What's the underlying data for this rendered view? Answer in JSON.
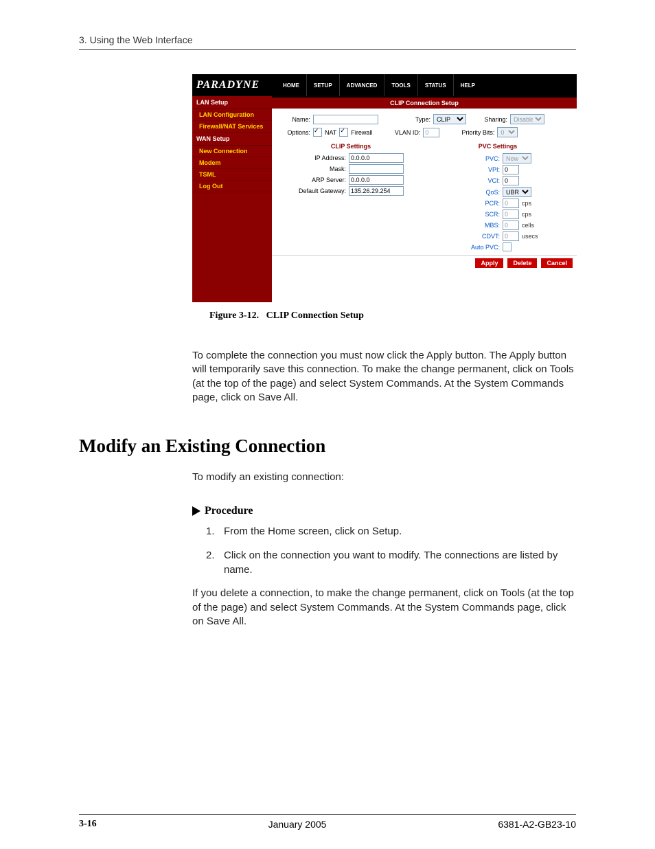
{
  "header": "3. Using the Web Interface",
  "brand": "PARADYNE",
  "nav": [
    "HOME",
    "SETUP",
    "ADVANCED",
    "TOOLS",
    "STATUS",
    "HELP"
  ],
  "sidebar": {
    "lan_setup": "LAN Setup",
    "lan_config": "LAN Configuration",
    "firewall": "Firewall/NAT Services",
    "wan_setup": "WAN Setup",
    "new_conn": "New Connection",
    "modem": "Modem",
    "tsml": "TSML",
    "logout": "Log Out"
  },
  "panel_title": "CLIP Connection Setup",
  "form": {
    "name_label": "Name:",
    "name_value": "",
    "type_label": "Type:",
    "type_value": "CLIP",
    "sharing_label": "Sharing:",
    "sharing_value": "Disable",
    "options_label": "Options:",
    "nat_label": "NAT",
    "firewall_label": "Firewall",
    "vlan_id_label": "VLAN ID:",
    "vlan_id_value": "0",
    "priority_label": "Priority Bits:",
    "priority_value": "0"
  },
  "clip_settings": {
    "title": "CLIP Settings",
    "ip_label": "IP Address:",
    "ip_value": "0.0.0.0",
    "mask_label": "Mask:",
    "mask_value": "",
    "arp_label": "ARP Server:",
    "arp_value": "0.0.0.0",
    "gw_label": "Default Gateway:",
    "gw_value": "135.26.29.254"
  },
  "pvc_settings": {
    "title": "PVC Settings",
    "pvc_label": "PVC:",
    "pvc_value": "New",
    "vpi_label": "VPI:",
    "vpi_value": "0",
    "vci_label": "VCI:",
    "vci_value": "0",
    "qos_label": "QoS:",
    "qos_value": "UBR",
    "pcr_label": "PCR:",
    "pcr_value": "0",
    "pcr_unit": "cps",
    "scr_label": "SCR:",
    "scr_value": "0",
    "scr_unit": "cps",
    "mbs_label": "MBS:",
    "mbs_value": "0",
    "mbs_unit": "cells",
    "cdvt_label": "CDVT:",
    "cdvt_value": "0",
    "cdvt_unit": "usecs",
    "autopvc_label": "Auto PVC:"
  },
  "buttons": {
    "apply": "Apply",
    "delete": "Delete",
    "cancel": "Cancel"
  },
  "figure_caption_num": "Figure 3-12.",
  "figure_caption_text": "CLIP Connection Setup",
  "para1": "To complete the connection you must now click the Apply button. The Apply button will temporarily save this connection. To make the change permanent, click on Tools (at the top of the page) and select System Commands. At the System Commands page, click on Save All.",
  "section_title": "Modify an Existing Connection",
  "para2": "To modify an existing connection:",
  "procedure_label": "Procedure",
  "steps": [
    "From the Home screen, click on Setup.",
    "Click on the connection you want to modify. The connections are listed by name."
  ],
  "para3": "If you delete a connection, to make the change permanent, click on Tools (at the top of the page) and select System Commands. At the System Commands page, click on Save All.",
  "footer": {
    "left": "3-16",
    "center": "January 2005",
    "right": "6381-A2-GB23-10"
  }
}
